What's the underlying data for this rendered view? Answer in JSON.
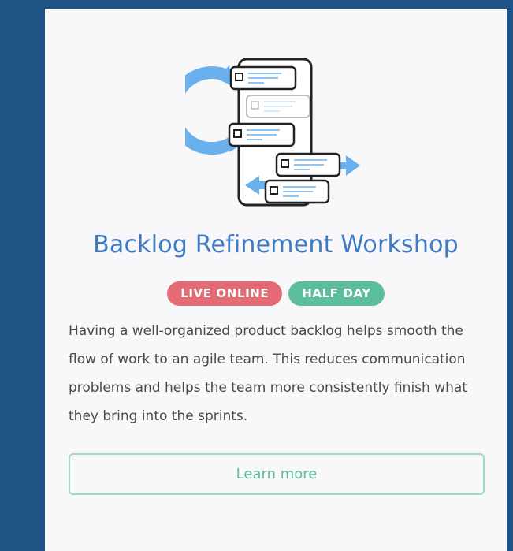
{
  "card": {
    "title": "Backlog Refinement Workshop",
    "illustration": "backlog-refinement-icon",
    "badges": [
      {
        "label": "LIVE ONLINE",
        "color": "#e46a73"
      },
      {
        "label": "HALF DAY",
        "color": "#5bbf9f"
      }
    ],
    "description": "Having a well-organized product backlog helps smooth the flow of work to an agile team. This reduces communication problems and helps the team more consistently finish what they bring into the sprints.",
    "learn_more_label": "Learn more"
  },
  "colors": {
    "background": "#1f5285",
    "card": "#f8f8fa",
    "title": "#3e7bc4",
    "accent_green": "#5bbf9f",
    "accent_red": "#e46a73"
  }
}
